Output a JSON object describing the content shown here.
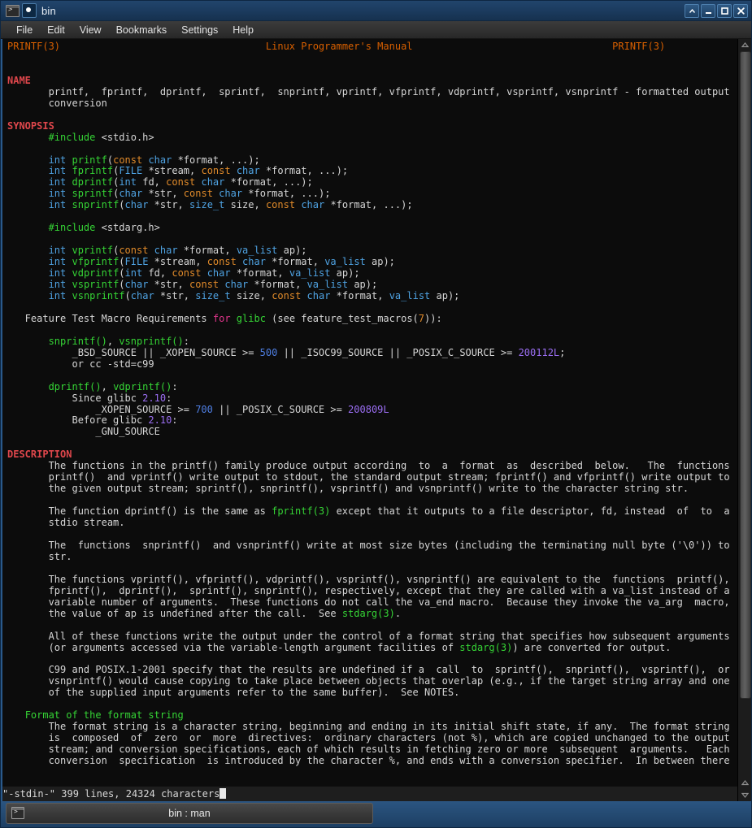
{
  "window": {
    "title": "bin",
    "icon": "terminal-icon",
    "badge_icon": "konsole-badge-icon",
    "controls": [
      {
        "name": "shade-button",
        "glyph": "^"
      },
      {
        "name": "minimize-button",
        "glyph": "_"
      },
      {
        "name": "maximize-button",
        "glyph": "□"
      },
      {
        "name": "close-button",
        "glyph": "✕"
      }
    ]
  },
  "menubar": {
    "items": [
      {
        "name": "menu-file",
        "label": "File"
      },
      {
        "name": "menu-edit",
        "label": "Edit"
      },
      {
        "name": "menu-view",
        "label": "View"
      },
      {
        "name": "menu-bookmarks",
        "label": "Bookmarks"
      },
      {
        "name": "menu-settings",
        "label": "Settings"
      },
      {
        "name": "menu-help",
        "label": "Help"
      }
    ]
  },
  "manpage": {
    "header_left": "PRINTF(3)",
    "header_center": "Linux Programmer's Manual",
    "header_right": "PRINTF(3)",
    "sections": {
      "name_title": "NAME",
      "name_body_1": "printf,  fprintf,  dprintf,  sprintf,  snprintf, vprintf, vfprintf, vdprintf, vsprintf, vsnprintf - formatted output",
      "name_body_2": "conversion",
      "synopsis_title": "SYNOPSIS",
      "include_stdio": "#include <stdio.h>",
      "include_stdarg": "#include <stdarg.h>",
      "feature_test_line": "Feature Test Macro Requirements for glibc (see feature_test_macros(7)):",
      "ftm_group1_head": "snprintf(), vsnprintf():",
      "ftm_group1_l1": "_BSD_SOURCE || _XOPEN_SOURCE >= 500 || _ISOC99_SOURCE || _POSIX_C_SOURCE >= 200112L;",
      "ftm_group1_l2": "or cc -std=c99",
      "ftm_group2_head": "dprintf(), vdprintf():",
      "ftm_group2_l1": "Since glibc 2.10:",
      "ftm_group2_l2": "_XOPEN_SOURCE >= 700 || _POSIX_C_SOURCE >= 200809L",
      "ftm_group2_l3": "Before glibc 2.10:",
      "ftm_group2_l4": "_GNU_SOURCE",
      "description_title": "DESCRIPTION",
      "subsection_format": "Format of the format string"
    },
    "prototypes": [
      "int printf(const char *format, ...);",
      "int fprintf(FILE *stream, const char *format, ...);",
      "int dprintf(int fd, const char *format, ...);",
      "int sprintf(char *str, const char *format, ...);",
      "int snprintf(char *str, size_t size, const char *format, ...);",
      "int vprintf(const char *format, va_list ap);",
      "int vfprintf(FILE *stream, const char *format, va_list ap);",
      "int vdprintf(int fd, const char *format, va_list ap);",
      "int vsprintf(char *str, const char *format, va_list ap);",
      "int vsnprintf(char *str, size_t size, const char *format, va_list ap);"
    ],
    "description_paragraphs": [
      [
        "The functions in the printf() family produce output according  to  a  format  as  described  below.   The  functions",
        "printf()  and vprintf() write output to stdout, the standard output stream; fprintf() and vfprintf() write output to",
        "the given output stream; sprintf(), snprintf(), vsprintf() and vsnprintf() write to the character string str."
      ],
      [
        "The function dprintf() is the same as fprintf(3) except that it outputs to a file descriptor, fd, instead  of  to  a",
        "stdio stream."
      ],
      [
        "The  functions  snprintf()  and vsnprintf() write at most size bytes (including the terminating null byte ('\\0')) to",
        "str."
      ],
      [
        "The functions vprintf(), vfprintf(), vdprintf(), vsprintf(), vsnprintf() are equivalent to the  functions  printf(),",
        "fprintf(),  dprintf(),  sprintf(), snprintf(), respectively, except that they are called with a va_list instead of a",
        "variable number of arguments.  These functions do not call the va_end macro.  Because they invoke the va_arg  macro,",
        "the value of ap is undefined after the call.  See stdarg(3)."
      ],
      [
        "All of these functions write the output under the control of a format string that specifies how subsequent arguments",
        "(or arguments accessed via the variable-length argument facilities of stdarg(3)) are converted for output."
      ],
      [
        "C99 and POSIX.1-2001 specify that the results are undefined if a  call  to  sprintf(),  snprintf(),  vsprintf(),  or",
        "vsnprintf() would cause copying to take place between objects that overlap (e.g., if the target string array and one",
        "of the supplied input arguments refer to the same buffer).  See NOTES."
      ],
      [
        "The format string is a character string, beginning and ending in its initial shift state, if any.  The format string",
        "is  composed  of  zero  or  more  directives:  ordinary characters (not %), which are copied unchanged to the output",
        "stream; and conversion specifications, each of which results in fetching zero or more  subsequent  arguments.   Each",
        "conversion  specification  is introduced by the character %, and ends with a conversion specifier.  In between there"
      ]
    ],
    "status_line": "\"-stdin-\" 399 lines, 24324 characters"
  },
  "scrollbar": {
    "up_arrow": "chevron-up-icon",
    "down_arrow": "chevron-down-icon",
    "bottom_up_arrow": "chevron-up-icon"
  },
  "tabbar": {
    "tab_label": "bin : man",
    "tab_icon": "terminal-icon"
  },
  "colors": {
    "section_heading": "#e0474c",
    "header_orange": "#d75f00",
    "function_green": "#35d435",
    "type_blue": "#4fa3e3",
    "const_orange": "#e08a2a",
    "keyword_magenta": "#e0358b",
    "number_violet": "#9b6ef3",
    "number_blue": "#4f7fe3",
    "terminal_bg": "#0c0c0c",
    "terminal_fg": "#d6d6d6",
    "titlebar_bg": "#1c3c60"
  }
}
